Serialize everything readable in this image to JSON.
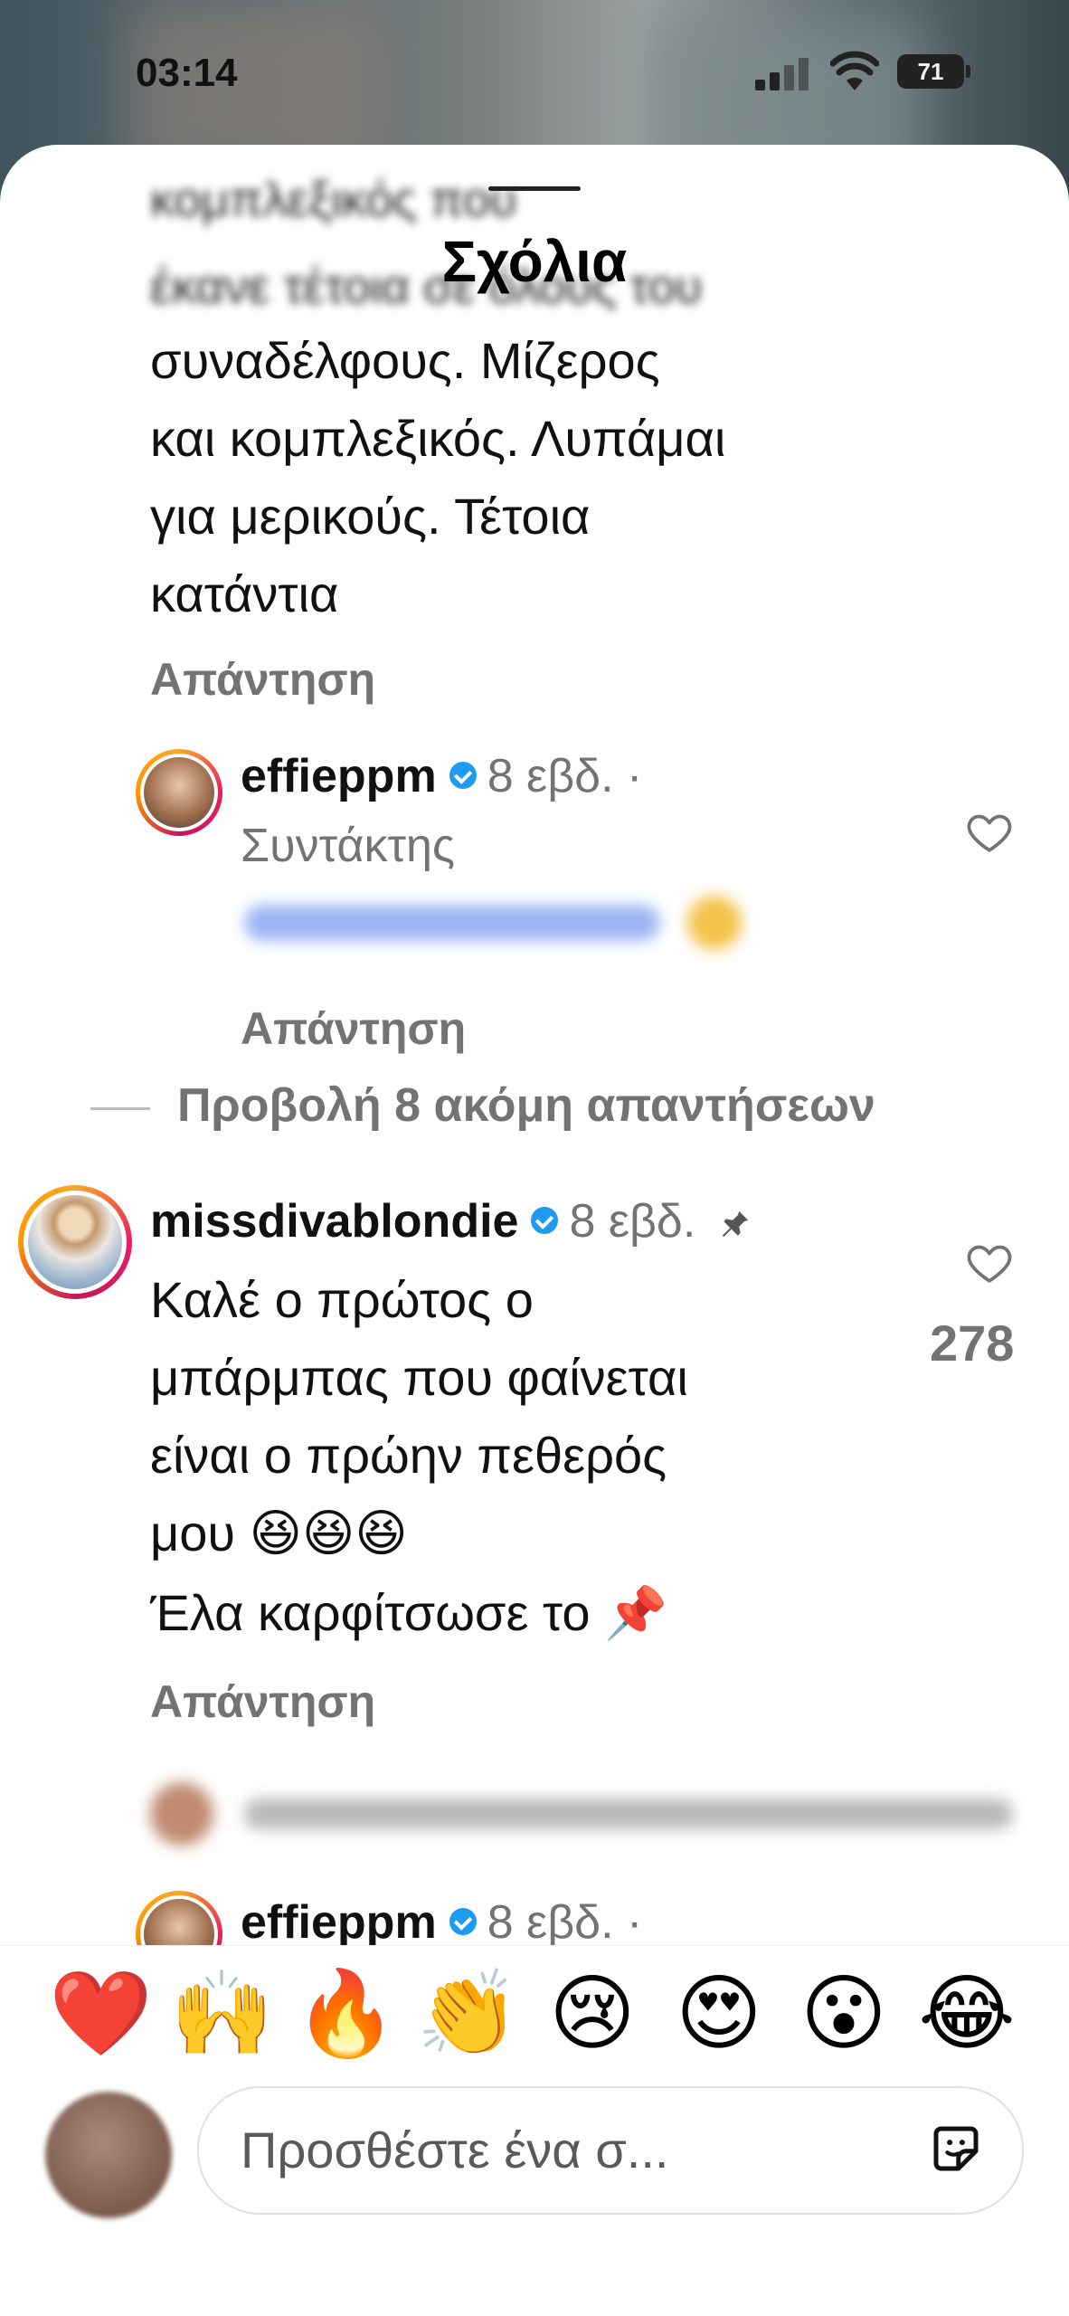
{
  "status_bar": {
    "time": "03:14",
    "battery": "71"
  },
  "sheet": {
    "title": "Σχόλια"
  },
  "comment1": {
    "lines": [
      "συναδέλφους. Μίζερος",
      "και κομπλεξικός. Λυπάμαι",
      "για μερικούς. Τέτοια",
      "κατάντια"
    ],
    "reply_label": "Απάντηση"
  },
  "reply1": {
    "username": "effieppm",
    "time": "8 εβδ.",
    "separator": "·",
    "role": "Συντάκτης",
    "reply_label": "Απάντηση"
  },
  "view_more": "Προβολή 8 ακόμη απαντήσεων",
  "comment2": {
    "username": "missdivablondie",
    "time": "8 εβδ.",
    "lines": [
      "Καλέ ο πρώτος ο",
      "μπάρμπας που φαίνεται",
      "είναι ο πρώην πεθερός",
      "μου 😆😆😆"
    ],
    "line2": "Έλα καρφίτσωσε το 📌",
    "likes": "278",
    "reply_label": "Απάντηση"
  },
  "reply2": {
    "username": "effieppm",
    "time": "8 εβδ.",
    "separator": "·"
  },
  "emoji_bar": [
    "❤️",
    "🙌",
    "🔥",
    "👏",
    "😢",
    "😍",
    "😮",
    "😂"
  ],
  "composer": {
    "placeholder": "Προσθέστε ένα σ..."
  }
}
